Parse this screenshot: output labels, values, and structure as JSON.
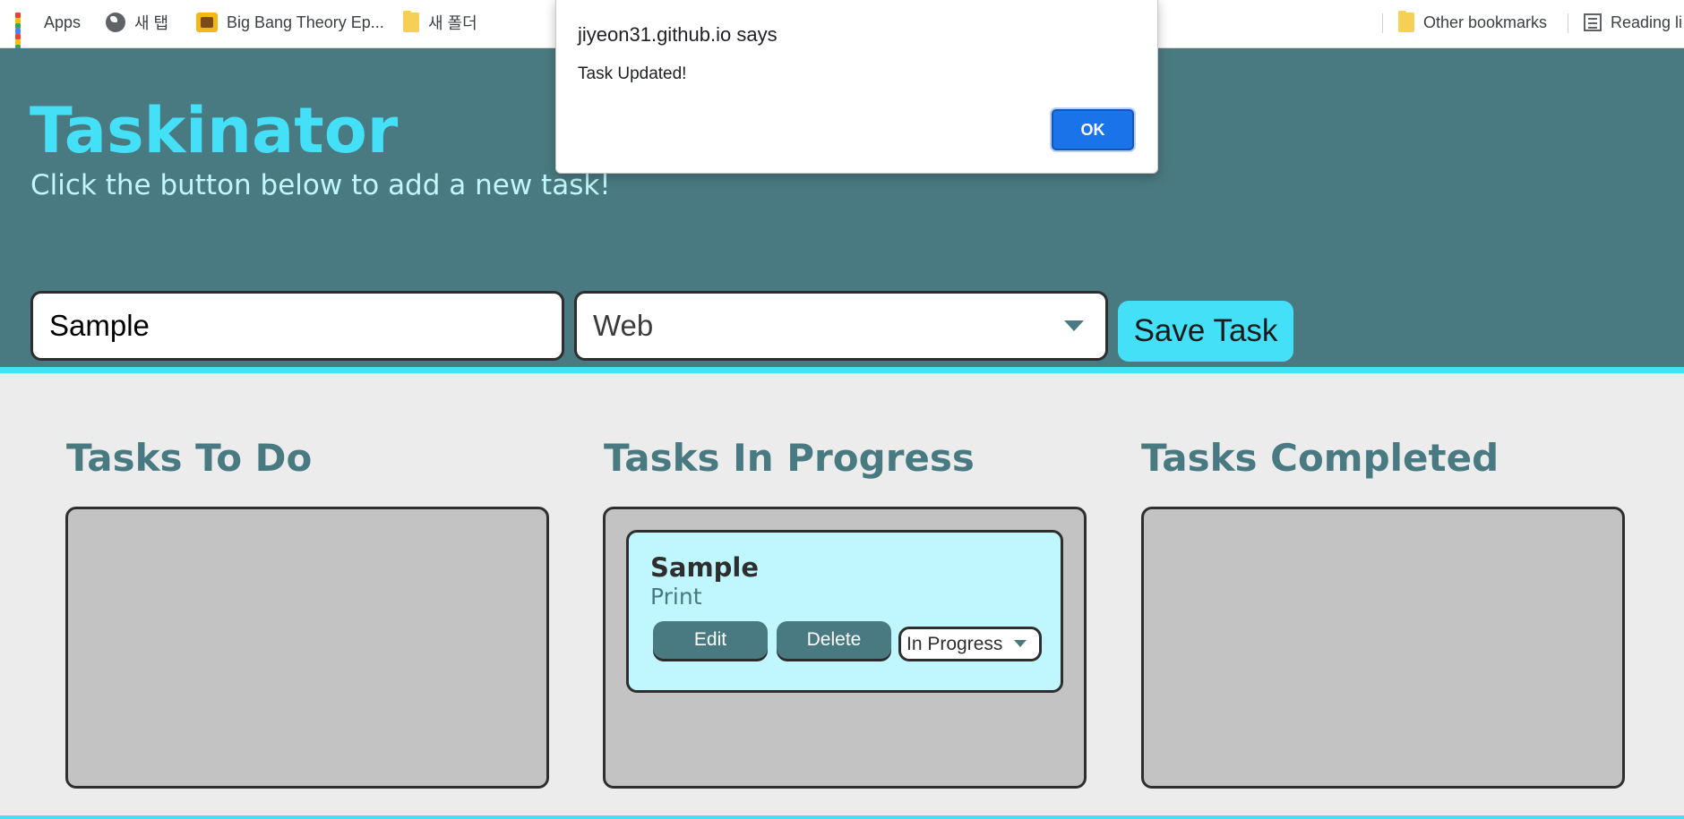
{
  "bookmarks_bar": {
    "apps": "Apps",
    "new_tab": "새 탭",
    "big_bang": "Big Bang Theory Ep...",
    "new_folder": "새 폴더",
    "other": "Other bookmarks",
    "reading": "Reading li",
    "apps_icon_colors": [
      "#ea4335",
      "#fbbc04",
      "#34a853",
      "#4285f4",
      "#ea4335",
      "#fbbc04",
      "#34a853",
      "#4285f4",
      "#ea4335"
    ]
  },
  "header": {
    "title": "Taskinator",
    "subtitle": "Click the button below to add a new task!",
    "task_name_value": "Sample",
    "task_type_value": "Web",
    "save_button": "Save Task"
  },
  "columns": [
    {
      "title": "Tasks To Do"
    },
    {
      "title": "Tasks In Progress"
    },
    {
      "title": "Tasks Completed"
    }
  ],
  "task_card": {
    "name": "Sample",
    "type": "Print",
    "edit": "Edit",
    "delete": "Delete",
    "status": "In Progress"
  },
  "dialog": {
    "title": "jiyeon31.github.io says",
    "message": "Task Updated!",
    "ok": "OK"
  },
  "colors": {
    "header_bg": "#4a7a81",
    "accent": "#44e0f7",
    "card_bg": "#c0f6fd",
    "column_bg": "#c3c3c3",
    "page_bg": "#ececec",
    "dialog_button": "#1a73e8"
  }
}
